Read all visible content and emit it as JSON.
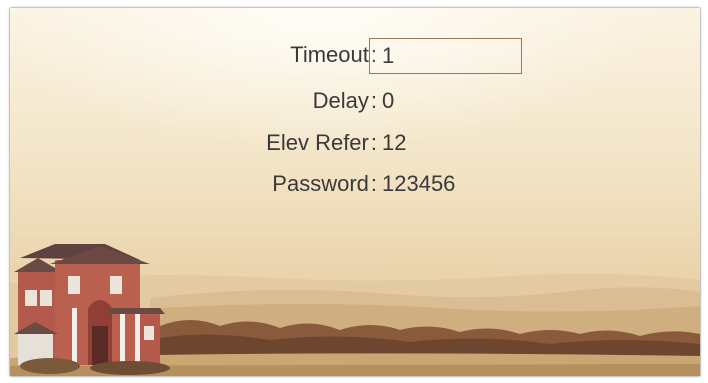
{
  "settings": {
    "timeout": {
      "label": "Timeout",
      "colon": ":",
      "value": "1"
    },
    "delay": {
      "label": "Delay",
      "colon": ":",
      "value": "0"
    },
    "elev_refer": {
      "label": "Elev Refer",
      "colon": ":",
      "value": "12"
    },
    "password": {
      "label": "Password",
      "colon": ":",
      "value": "123456"
    }
  },
  "colors": {
    "text": "#3a3a3a",
    "input_border": "#9a7a52",
    "sky_top": "#fbf3e3",
    "sky_bottom": "#e4c99c",
    "house_brick": "#b0564a",
    "house_roof": "#6b4a44"
  }
}
